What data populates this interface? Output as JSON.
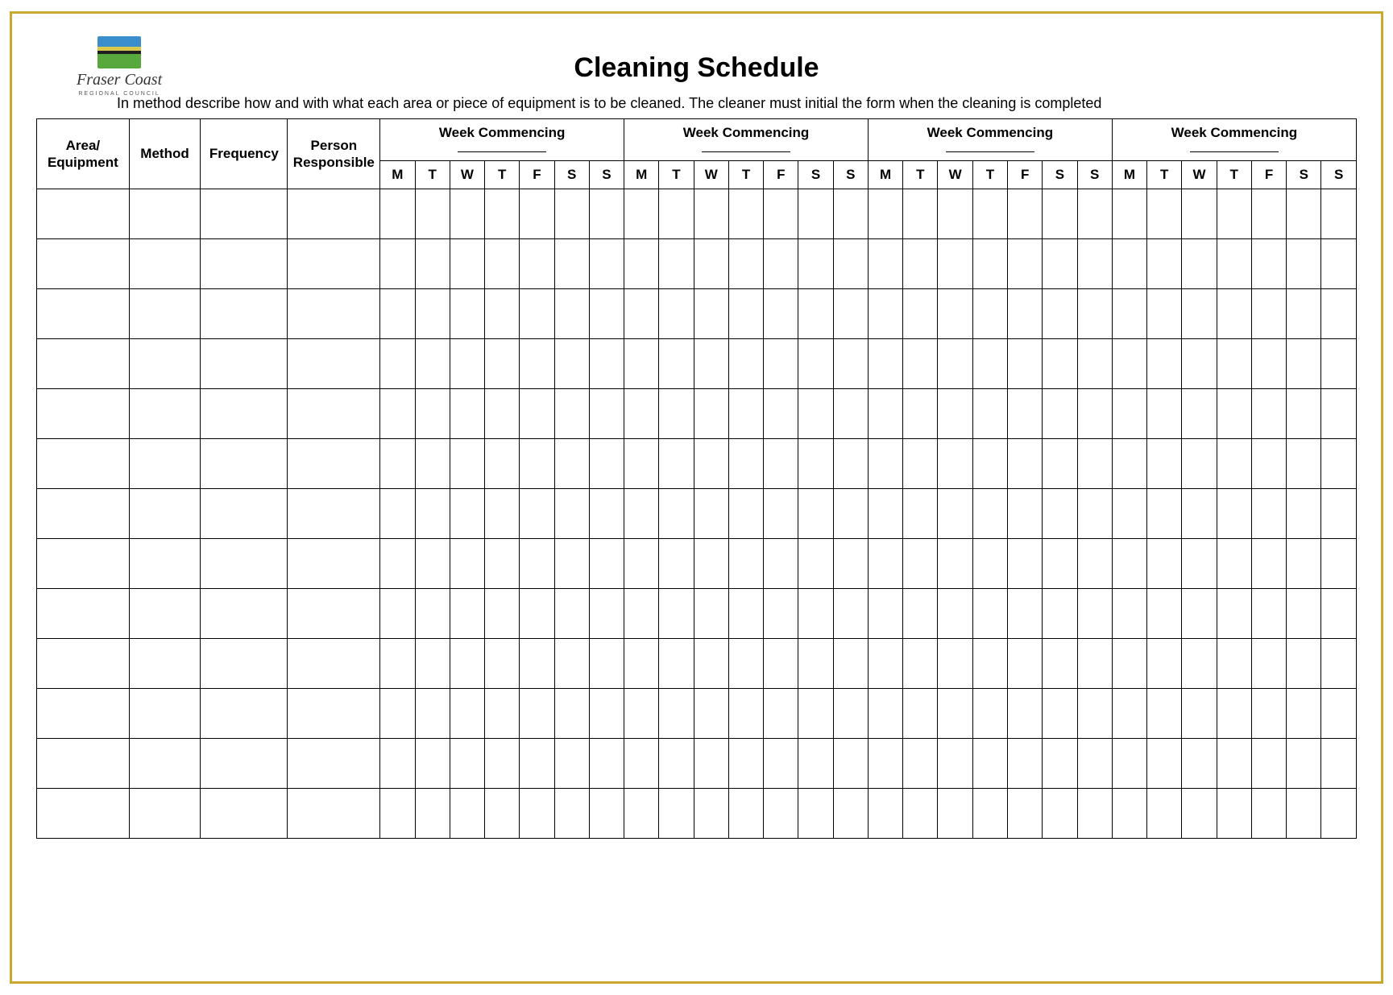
{
  "logo": {
    "name": "Fraser Coast",
    "sub": "REGIONAL COUNCIL"
  },
  "title": "Cleaning Schedule",
  "instruction": "In method describe how and with what each area or piece of equipment is to be cleaned. The cleaner  must initial the form when the cleaning is completed",
  "columns": {
    "area": "Area/ Equipment",
    "method": "Method",
    "frequency": "Frequency",
    "responsible": "Person Responsible",
    "week_label": "Week Commencing",
    "days": [
      "M",
      "T",
      "W",
      "T",
      "F",
      "S",
      "S"
    ]
  },
  "week_count": 4,
  "row_count": 13
}
